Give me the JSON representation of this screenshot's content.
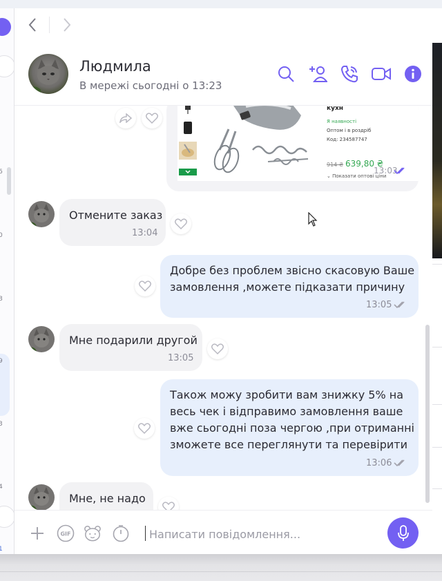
{
  "contact": {
    "name": "Людмила",
    "status": "В мережі сьогодні о 13:23"
  },
  "product": {
    "title": "насадки) / Міксер для кухн",
    "availability": "Я наявності",
    "wholesale": "Оптом і в роздріб",
    "code": "Код: 234587747",
    "old_price": "914 ₴",
    "new_price": "639,80 ₴",
    "show_wholesale": "Показати оптові ціни",
    "time": "13:03"
  },
  "messages": [
    {
      "direction": "in",
      "text": "Отмените заказ",
      "time": "13:04"
    },
    {
      "direction": "out",
      "lines": [
        "Добре без проблем звісно скасовую Ваше",
        "замовлення ,можете підказати причину"
      ],
      "time": "13:05"
    },
    {
      "direction": "in",
      "text": "Мне подарили другой",
      "time": "13:05"
    },
    {
      "direction": "out",
      "lines": [
        "Також можу зробити вам знижку 5% на",
        "весь чек і відправимо замовлення ваше",
        "вже сьогодні поза чергою ,при отриманні",
        "зможете все переглянути та перевірити"
      ],
      "time": "13:06"
    },
    {
      "direction": "in",
      "text": "Мне, не надо",
      "time": ""
    }
  ],
  "composer": {
    "placeholder": "Написати повідомлення..."
  },
  "sidebar": {
    "numbers": [
      "6",
      "0",
      "8",
      "9",
      "3",
      "4",
      "1"
    ]
  },
  "colors": {
    "accent": "#7360f2",
    "incoming_bubble": "#f2f2f4",
    "outgoing_bubble": "#e7effc",
    "price_green": "#34a853"
  },
  "icons": {
    "header": [
      "search-icon",
      "add-participant-icon",
      "call-icon",
      "video-call-icon",
      "info-icon"
    ],
    "composer": [
      "plus-icon",
      "gif-icon",
      "sticker-icon",
      "timer-icon",
      "microphone-icon"
    ]
  }
}
